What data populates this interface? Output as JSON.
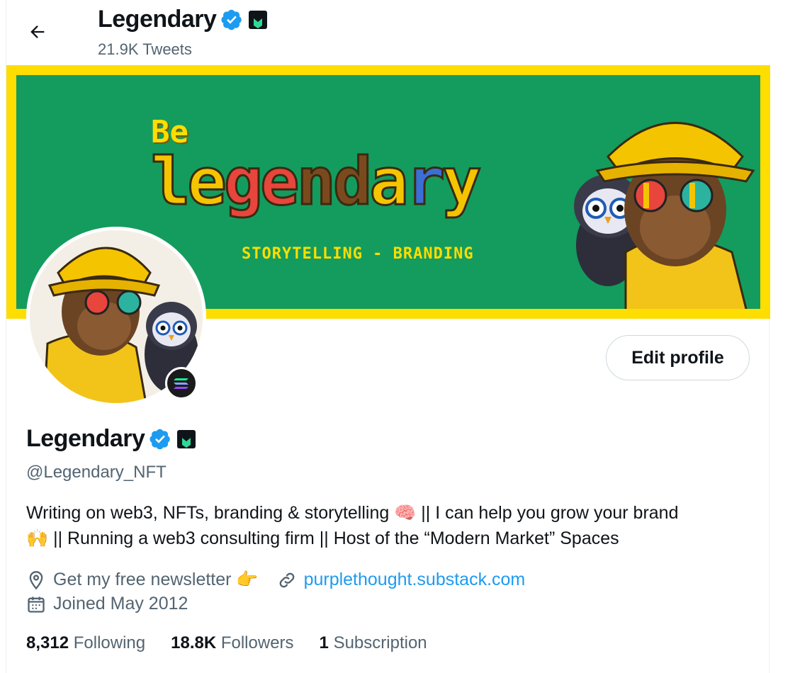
{
  "header": {
    "title": "Legendary",
    "subtitle": "21.9K Tweets"
  },
  "banner": {
    "top_text": "Be",
    "main_text": "legendary",
    "tagline": "STORYTELLING - BRANDING"
  },
  "profile": {
    "name": "Legendary",
    "handle": "@Legendary_NFT",
    "bio_line1": "Writing on web3, NFTs, branding & storytelling 🧠 || I can help you grow your brand",
    "bio_line2": "🙌 || Running a web3 consulting firm || Host of the “Modern Market” Spaces",
    "location": "Get my free newsletter 👉",
    "website": "purplethought.substack.com",
    "joined": "Joined May 2012",
    "edit_label": "Edit profile"
  },
  "stats": {
    "following_count": "8,312",
    "following_label": "Following",
    "followers_count": "18.8K",
    "followers_label": "Followers",
    "subs_count": "1",
    "subs_label": "Subscription"
  },
  "colors": {
    "accent": "#1d9bf0",
    "banner_border": "#fedd00",
    "banner_bg": "#139c5e"
  },
  "icons": [
    "back-arrow-icon",
    "verified-badge-icon",
    "corp-badge-icon",
    "location-icon",
    "link-icon",
    "calendar-icon",
    "solana-icon"
  ]
}
